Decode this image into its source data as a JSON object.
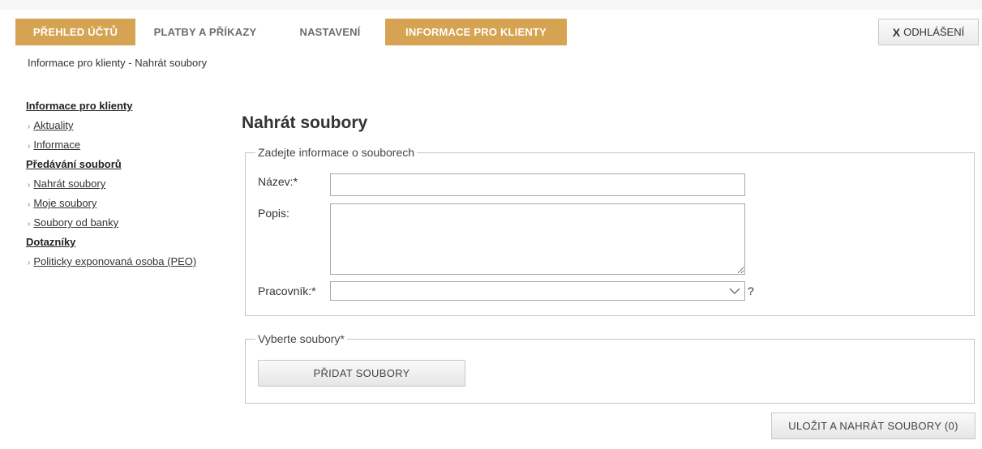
{
  "nav": {
    "tabs": [
      {
        "label": "PŘEHLED ÚČTŮ",
        "active": true
      },
      {
        "label": "PLATBY A PŘÍKAZY",
        "active": false
      },
      {
        "label": "NASTAVENÍ",
        "active": false
      },
      {
        "label": "INFORMACE PRO KLIENTY",
        "active": true
      }
    ],
    "logout_x": "X",
    "logout_label": "ODHLÁŠENÍ"
  },
  "breadcrumb": "Informace pro klienty - Nahrát soubory",
  "sidebar": {
    "sections": [
      {
        "heading": "Informace pro klienty",
        "items": [
          "Aktuality",
          "Informace"
        ]
      },
      {
        "heading": "Předávání souborů",
        "items": [
          "Nahrát soubory",
          "Moje soubory",
          "Soubory od banky"
        ]
      },
      {
        "heading": "Dotazníky",
        "items": [
          "Politicky exponovaná osoba (PEO)"
        ]
      }
    ]
  },
  "main": {
    "title": "Nahrát soubory",
    "info_legend": "Zadejte informace o souborech",
    "nazev_label": "Název:*",
    "nazev_value": "",
    "popis_label": "Popis:",
    "popis_value": "",
    "pracovnik_label": "Pracovník:*",
    "pracovnik_value": "",
    "help_mark": "?",
    "files_legend": "Vyberte soubory*",
    "add_files_label": "PŘIDAT SOUBORY",
    "save_label": "ULOŽIT A NAHRÁT SOUBORY (0)"
  },
  "colors": {
    "accent": "#d6a352",
    "tab_text": "#6d6d6d"
  },
  "icons": {
    "select_chevron": "chevron-down-icon",
    "sidebar_arrow": "›"
  }
}
